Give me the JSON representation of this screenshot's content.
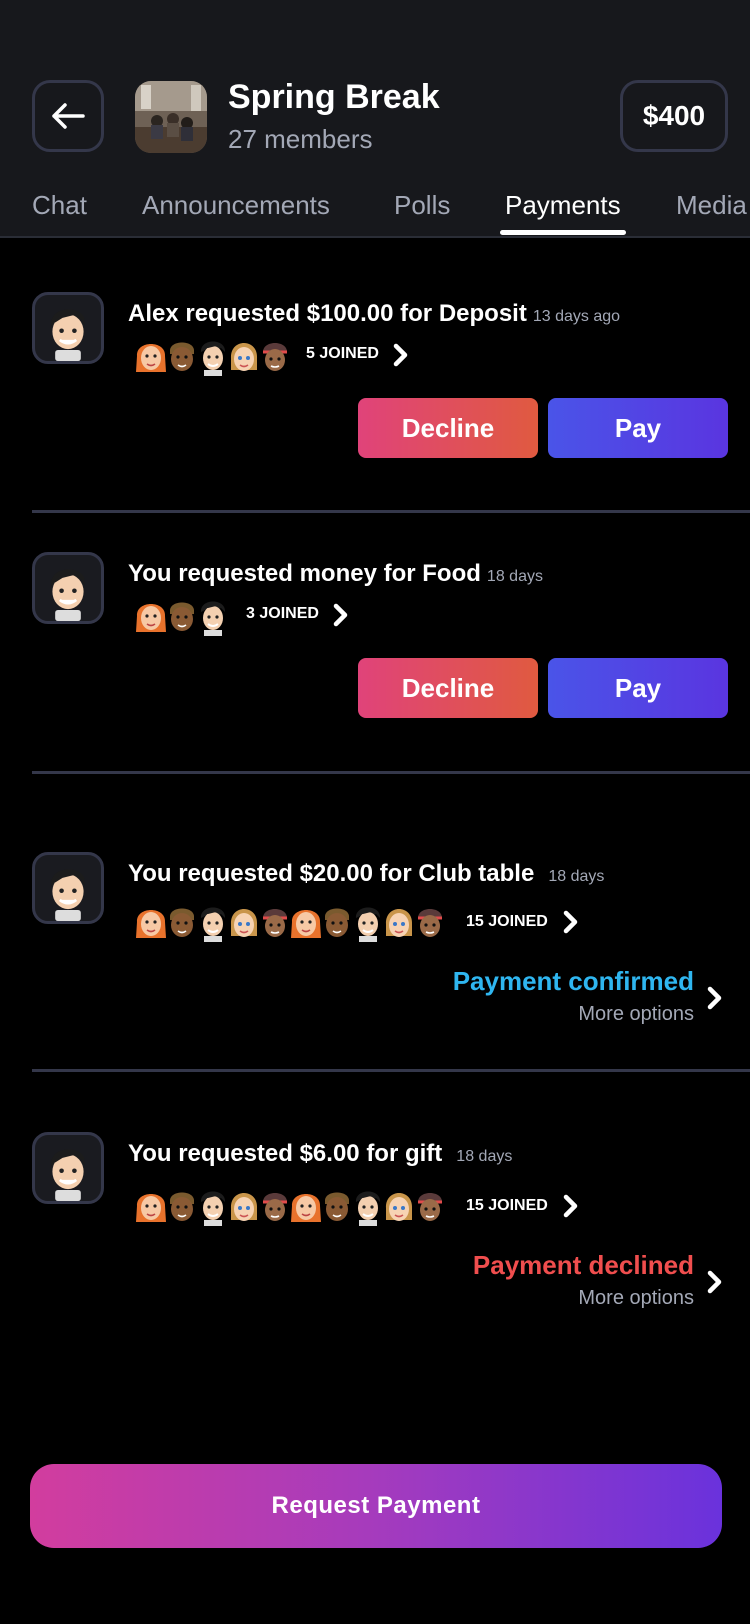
{
  "header": {
    "title": "Spring Break",
    "members": "27 members",
    "balance": "$400",
    "tabs": [
      "Chat",
      "Announcements",
      "Polls",
      "Payments",
      "Media"
    ],
    "active_tab": "Payments"
  },
  "payments": [
    {
      "requester_text": "Alex requested $100.00 for Deposit",
      "time": "13 days ago",
      "joined": "5 JOINED",
      "decline_label": "Decline",
      "pay_label": "Pay"
    },
    {
      "requester_text": "You requested money for Food",
      "time": "18 days",
      "joined": "3 JOINED",
      "decline_label": "Decline",
      "pay_label": "Pay"
    },
    {
      "requester_text": "You requested $20.00 for Club table",
      "time": "18 days",
      "joined": "15 JOINED",
      "status": "Payment confirmed",
      "status_color": "#2fb6f0",
      "more": "More options"
    },
    {
      "requester_text": "You requested $6.00 for gift",
      "time": "18 days",
      "joined": "15 JOINED",
      "status": "Payment declined",
      "status_color": "#f04e4e",
      "more": "More options"
    }
  ],
  "request_button": "Request Payment",
  "colors": {
    "header_bg": "#17181c",
    "decline_gradient": [
      "#e0437a",
      "#e05a40"
    ],
    "pay_gradient": [
      "#4a54e8",
      "#5a35e0"
    ],
    "request_gradient": [
      "#d23d9e",
      "#6a32dc"
    ]
  },
  "icons": {
    "back": "arrow-left-icon",
    "chevron": "chevron-right-icon"
  }
}
